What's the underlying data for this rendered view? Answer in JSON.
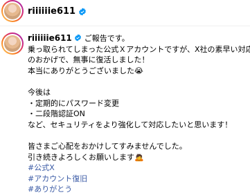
{
  "post": {
    "username": "riiiiiie611",
    "verified": true
  },
  "comment": {
    "username": "riiiiiie611",
    "intro": "ご報告です。",
    "lines": [
      "乗っ取られてしまった公式Ｘアカウントですが、X社の素早い対応",
      "のおかげで、無事に復活しました！",
      "本当にありがとうございました😭"
    ],
    "lines2": [
      "今後は",
      "・定期的にパスワード変更",
      "・二段階認証ON",
      "など、セキュリティをより強化して対応したいと思います！"
    ],
    "lines3": [
      "皆さまご心配をおかけしてすみませんでした。",
      "引き続きよろしくお願いします🙇"
    ],
    "hashtags": [
      "#公式X",
      "#アカウント復旧",
      "#ありがとう"
    ]
  },
  "colors": {
    "verified": "#0095f6",
    "hashtag": "#3a5aa5"
  }
}
